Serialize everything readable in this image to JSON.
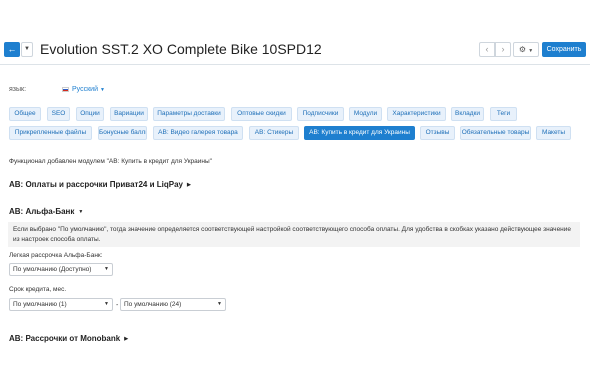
{
  "header": {
    "title": "Evolution SST.2 XO Complete Bike 10SPD12",
    "back_icon": "arrow-left-icon",
    "save_label": "Сохранить",
    "settings_icon": "gear-icon"
  },
  "language": {
    "label": "язык:",
    "value": "Русский"
  },
  "tabs_row1": [
    "Общее",
    "SEO",
    "Опции",
    "Вариации",
    "Параметры доставки",
    "Оптовые скидки",
    "Подписчики",
    "Модули",
    "Характеристики",
    "Вкладки",
    "Теги"
  ],
  "tabs_row2": [
    "Прикрепленные файлы",
    "Бонусные баллы",
    "AB: Видео галерея товара",
    "AB: Стикеры",
    "AB: Купить в кредит для Украины",
    "Отзывы",
    "Обязательные товары",
    "Макеты"
  ],
  "active_tab": "AB: Купить в кредит для Украины",
  "note": "Функционал добавлен модулем \"AB: Купить в кредит для Украины\"",
  "sections": {
    "privat": "AB: Оплаты и рассрочки Приват24 и LiqPay",
    "alfa": "AB: Альфа-Банк",
    "mono": "AB: Рассрочки от Monobank"
  },
  "info_text": "Если выбрано \"По умолчанию\", тогда значение определяется соответствующей настройкой соответствующего способа оплаты. Для удобства в скобках указано действующее значение из настроек способа оплаты.",
  "fields": {
    "easy_label": "Легкая рассрочка Альфа-Банк:",
    "easy_value": "По умолчанию (Доступно)",
    "term_label": "Срок кредита, мес.",
    "term_from": "По умолчанию (1)",
    "term_dash": "-",
    "term_to": "По умолчанию (24)"
  },
  "colors": {
    "accent": "#1e7fcf",
    "tab_bg": "#e8f1fb"
  }
}
